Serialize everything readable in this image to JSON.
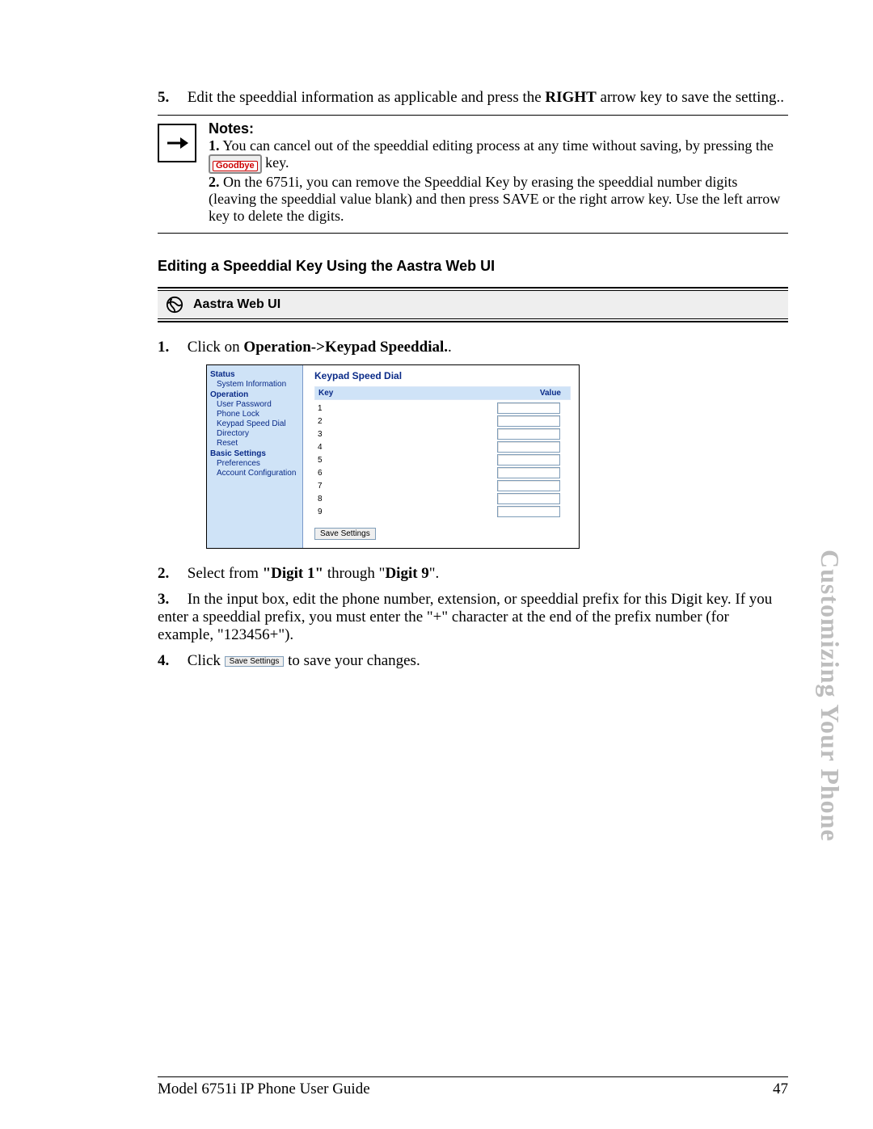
{
  "steps_a": {
    "5": {
      "num": "5.",
      "pre": "Edit the speeddial information as applicable and press the ",
      "bold": "RIGHT",
      "post": " arrow key to save the setting.."
    }
  },
  "notes": {
    "title": "Notes:",
    "n1_num": "1.",
    "n1_text_a": "You can cancel out of the speeddial editing process at any time without saving, by pressing the ",
    "n1_text_b": " key.",
    "goodbye": "Goodbye",
    "n2_num": "2.",
    "n2_text": "On the 6751i, you can remove the Speeddial Key by erasing the speeddial number digits (leaving the speeddial value blank) and then press SAVE or the right arrow key. Use the left arrow key to delete the digits."
  },
  "section_head": "Editing a Speeddial Key Using the Aastra Web UI",
  "webui_bar": "Aastra Web UI",
  "steps_b": {
    "1": {
      "num": "1.",
      "pre": "Click on ",
      "bold": "Operation->Keypad Speeddial.",
      "post": "."
    },
    "2": {
      "num": "2.",
      "pre": "Select from ",
      "bold1": "\"Digit 1\"",
      "mid": " through \"",
      "bold2": "Digit 9",
      "post": "\"."
    },
    "3": {
      "num": "3.",
      "text": "In the input box, edit the phone number, extension, or speeddial prefix for this Digit key. If you enter a speeddial prefix, you must enter the \"+\" character at the end of the prefix number (for example, \"123456+\")."
    },
    "4": {
      "num": "4.",
      "pre": "Click ",
      "btn": "Save Settings",
      "post": " to save your changes."
    }
  },
  "webui": {
    "nav": {
      "status": "Status",
      "sysinfo": "System Information",
      "operation": "Operation",
      "userpw": "User Password",
      "phonelock": "Phone Lock",
      "ksd": "Keypad Speed Dial",
      "directory": "Directory",
      "reset": "Reset",
      "basic": "Basic Settings",
      "prefs": "Preferences",
      "account": "Account Configuration"
    },
    "title": "Keypad Speed Dial",
    "col_key": "Key",
    "col_val": "Value",
    "keys": [
      "1",
      "2",
      "3",
      "4",
      "5",
      "6",
      "7",
      "8",
      "9"
    ],
    "save": "Save Settings"
  },
  "side_title": "Customizing Your Phone",
  "footer_left": "Model 6751i IP Phone User Guide",
  "footer_right": "47"
}
